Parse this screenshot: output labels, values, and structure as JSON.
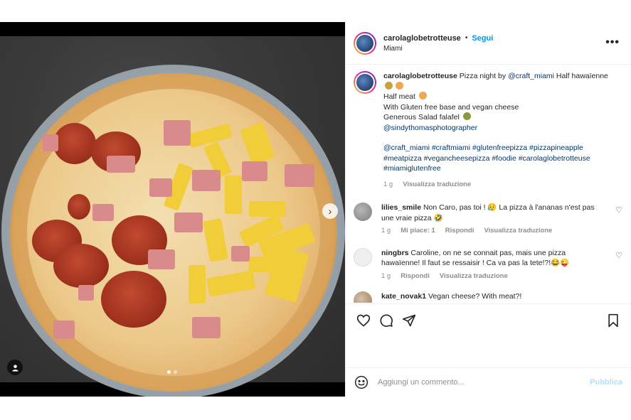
{
  "post": {
    "username": "carolaglobetrotteuse",
    "bullet": "•",
    "follow_label": "Segui",
    "location": "Miami",
    "more_label": "•••"
  },
  "caption": {
    "username": "carolaglobetrotteuse",
    "text_1": "Pizza night by",
    "mention_1": "@craft_miami",
    "text_2": "Half hawaïenne",
    "line_2": "Half meat",
    "line_3": "With Gluten free base and vegan cheese",
    "line_4": "Generous Salad falafel",
    "mention_2": "@sindythomasphotographer",
    "hashtags": "@craft_miami #craftmiami #glutenfreepizza #pizzapineapple #meatpizza #vegancheesepizza #foodie #carolaglobetrotteuse #miamiglutenfree",
    "time": "1 g",
    "translate": "Visualizza traduzione"
  },
  "comments": [
    {
      "username": "lilies_smile",
      "text": "Non Caro, pas toi ! 😥 La pizza à l'ananas n'est pas une vraie pizza 🤣",
      "time": "1 g",
      "likes": "Mi piace: 1",
      "reply": "Rispondi",
      "translate": "Visualizza traduzione"
    },
    {
      "username": "ningbrs",
      "text": "Caroline, on ne se connait pas, mais une pizza hawaïenne! Il faut se ressaisir ! Ca va pas la tete!?!😂😜",
      "time": "1 g",
      "reply": "Rispondi",
      "translate": "Visualizza traduzione"
    },
    {
      "username": "kate_novak1",
      "text": "Vegan cheese? With meat?!"
    }
  ],
  "composer": {
    "placeholder": "Aggiungi un commento...",
    "publish_label": "Pubblica"
  },
  "icons": {
    "like": "heart-icon",
    "comment": "comment-icon",
    "share": "paper-plane-icon",
    "save": "bookmark-icon",
    "emoji": "smiley-icon",
    "next": "chevron-right-icon",
    "tagged": "user-icon"
  },
  "colors": {
    "link": "#00376b",
    "follow": "#0095f6",
    "publish_disabled": "#b2dffc"
  }
}
